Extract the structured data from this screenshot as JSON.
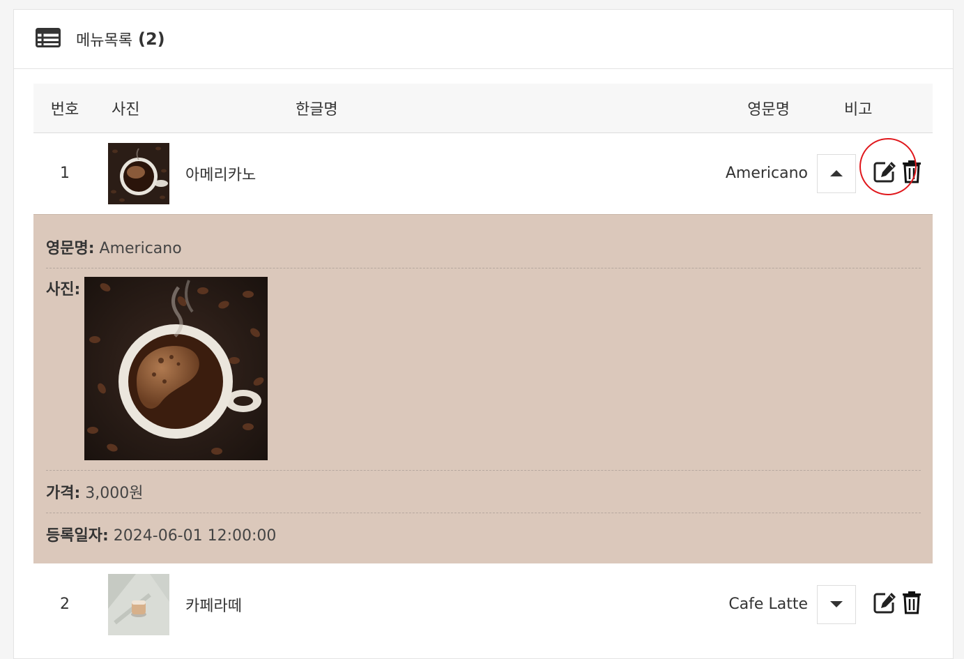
{
  "header": {
    "title": "메뉴목록",
    "count": "(2)",
    "icon": "table-list-icon"
  },
  "columns": {
    "num": "번호",
    "photo": "사진",
    "kname": "한글명",
    "ename": "영문명",
    "note": "비고"
  },
  "rows": [
    {
      "num": "1",
      "kname": "아메리카노",
      "ename": "Americano",
      "expanded": true
    },
    {
      "num": "2",
      "kname": "카페라떼",
      "ename": "Cafe Latte",
      "expanded": false
    }
  ],
  "detail": {
    "ename_label": "영문명:",
    "ename_value": "Americano",
    "photo_label": "사진:",
    "price_label": "가격:",
    "price_value": "3,000원",
    "date_label": "등록일자:",
    "date_value": "2024-06-01 12:00:00"
  },
  "icons": {
    "collapse": "caret-up-icon",
    "expand": "caret-down-icon",
    "edit": "edit-icon",
    "delete": "trash-icon"
  },
  "colors": {
    "detail_bg": "#dbc8bb",
    "highlight": "#e0171c"
  }
}
